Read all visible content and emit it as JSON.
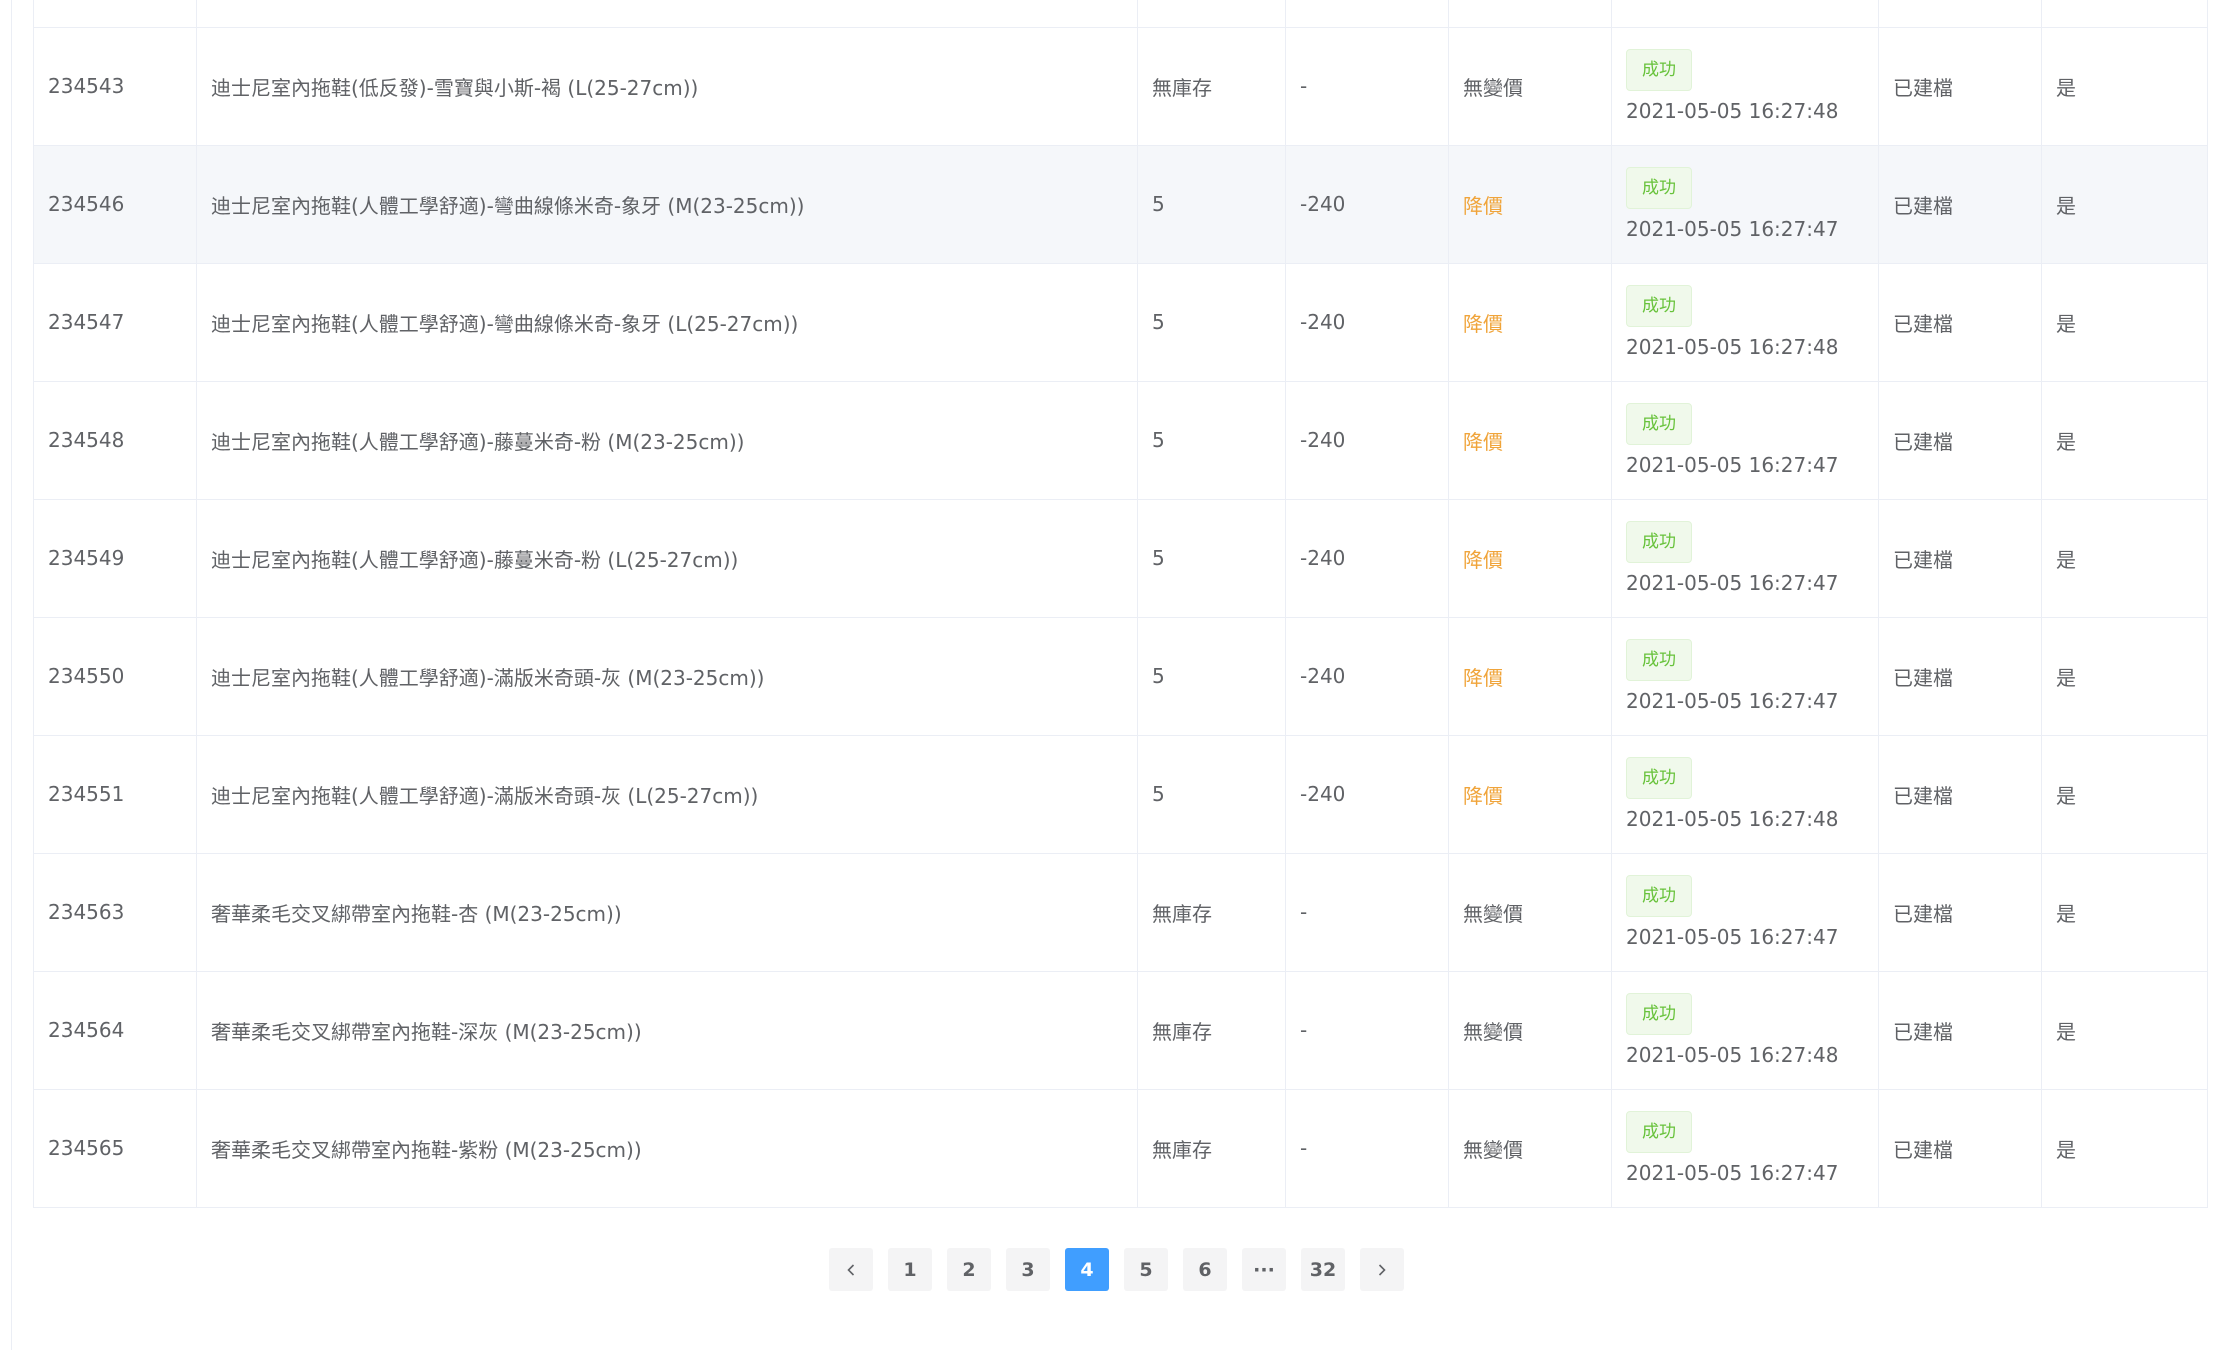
{
  "table": {
    "rows": [
      {
        "id": "234543",
        "name": "迪士尼室內拖鞋(低反發)-雪寶與小斯-褐 (L(25-27cm))",
        "stock": "無庫存",
        "diff": "-",
        "price_status": "無變價",
        "sync_tag": "成功",
        "sync_time": "2021-05-05 16:27:48",
        "build": "已建檔",
        "enabled": "是"
      },
      {
        "id": "234546",
        "name": "迪士尼室內拖鞋(人體工學舒適)-彎曲線條米奇-象牙 (M(23-25cm))",
        "stock": "5",
        "diff": "-240",
        "price_status": "降價",
        "sync_tag": "成功",
        "sync_time": "2021-05-05 16:27:47",
        "build": "已建檔",
        "enabled": "是"
      },
      {
        "id": "234547",
        "name": "迪士尼室內拖鞋(人體工學舒適)-彎曲線條米奇-象牙 (L(25-27cm))",
        "stock": "5",
        "diff": "-240",
        "price_status": "降價",
        "sync_tag": "成功",
        "sync_time": "2021-05-05 16:27:48",
        "build": "已建檔",
        "enabled": "是"
      },
      {
        "id": "234548",
        "name": "迪士尼室內拖鞋(人體工學舒適)-藤蔓米奇-粉 (M(23-25cm))",
        "stock": "5",
        "diff": "-240",
        "price_status": "降價",
        "sync_tag": "成功",
        "sync_time": "2021-05-05 16:27:47",
        "build": "已建檔",
        "enabled": "是"
      },
      {
        "id": "234549",
        "name": "迪士尼室內拖鞋(人體工學舒適)-藤蔓米奇-粉 (L(25-27cm))",
        "stock": "5",
        "diff": "-240",
        "price_status": "降價",
        "sync_tag": "成功",
        "sync_time": "2021-05-05 16:27:47",
        "build": "已建檔",
        "enabled": "是"
      },
      {
        "id": "234550",
        "name": "迪士尼室內拖鞋(人體工學舒適)-滿版米奇頭-灰 (M(23-25cm))",
        "stock": "5",
        "diff": "-240",
        "price_status": "降價",
        "sync_tag": "成功",
        "sync_time": "2021-05-05 16:27:47",
        "build": "已建檔",
        "enabled": "是"
      },
      {
        "id": "234551",
        "name": "迪士尼室內拖鞋(人體工學舒適)-滿版米奇頭-灰 (L(25-27cm))",
        "stock": "5",
        "diff": "-240",
        "price_status": "降價",
        "sync_tag": "成功",
        "sync_time": "2021-05-05 16:27:48",
        "build": "已建檔",
        "enabled": "是"
      },
      {
        "id": "234563",
        "name": "奢華柔毛交叉綁帶室內拖鞋-杏 (M(23-25cm))",
        "stock": "無庫存",
        "diff": "-",
        "price_status": "無變價",
        "sync_tag": "成功",
        "sync_time": "2021-05-05 16:27:47",
        "build": "已建檔",
        "enabled": "是"
      },
      {
        "id": "234564",
        "name": "奢華柔毛交叉綁帶室內拖鞋-深灰 (M(23-25cm))",
        "stock": "無庫存",
        "diff": "-",
        "price_status": "無變價",
        "sync_tag": "成功",
        "sync_time": "2021-05-05 16:27:48",
        "build": "已建檔",
        "enabled": "是"
      },
      {
        "id": "234565",
        "name": "奢華柔毛交叉綁帶室內拖鞋-紫粉 (M(23-25cm))",
        "stock": "無庫存",
        "diff": "-",
        "price_status": "無變價",
        "sync_tag": "成功",
        "sync_time": "2021-05-05 16:27:47",
        "build": "已建檔",
        "enabled": "是"
      }
    ]
  },
  "pagination": {
    "prev_icon": "chevron-left-icon",
    "next_icon": "chevron-right-icon",
    "pages": [
      "1",
      "2",
      "3",
      "4",
      "5",
      "6",
      "···",
      "32"
    ],
    "current": "4"
  },
  "colors": {
    "border": "#ebeef5",
    "price_down": "#f0a43a",
    "success_text": "#67c23a",
    "success_bg": "#f0f9eb",
    "pager_active": "#409eff",
    "row_hover": "#f5f7fa"
  }
}
